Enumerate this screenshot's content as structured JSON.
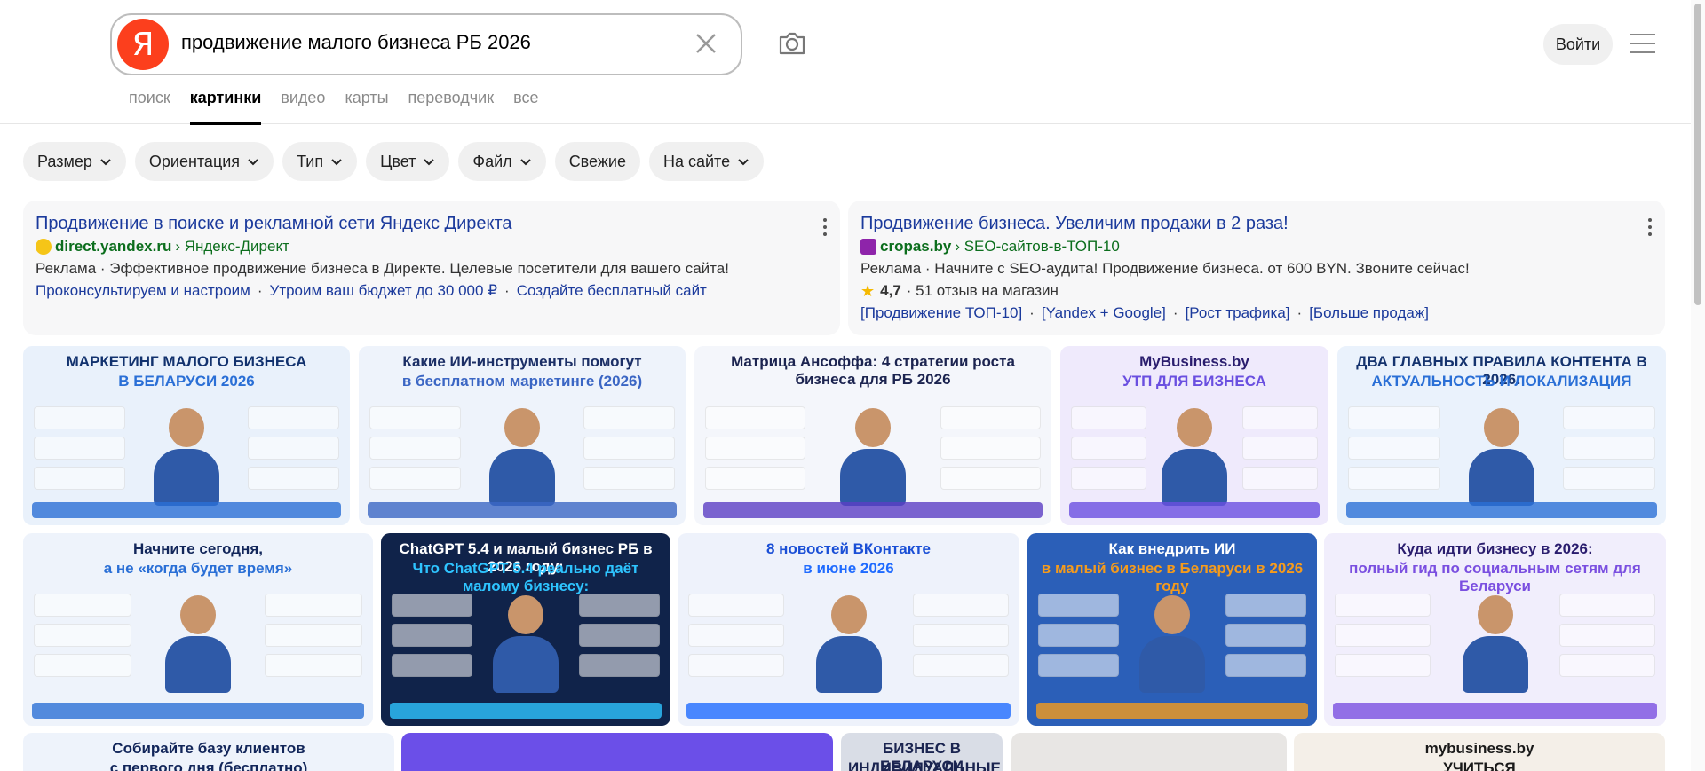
{
  "search": {
    "logo": "Я",
    "query": "продвижение малого бизнеса РБ 2026"
  },
  "header": {
    "login_label": "Войти"
  },
  "tabs": [
    {
      "label": "поиск"
    },
    {
      "label": "картинки"
    },
    {
      "label": "видео"
    },
    {
      "label": "карты"
    },
    {
      "label": "переводчик"
    },
    {
      "label": "все"
    }
  ],
  "filters": [
    {
      "label": "Размер"
    },
    {
      "label": "Ориентация"
    },
    {
      "label": "Тип"
    },
    {
      "label": "Цвет"
    },
    {
      "label": "Файл"
    },
    {
      "label": "Свежие"
    },
    {
      "label": "На сайте"
    }
  ],
  "ads": [
    {
      "title": "Продвижение в поиске и рекламной сети Яндекс Директа",
      "domain": "direct.yandex.ru",
      "path": "› Яндекс-Директ",
      "desc": "Реклама · Эффективное продвижение бизнеса в Директе. Целевые посетители для вашего сайта!",
      "links": [
        "Проконсультируем и настроим",
        "Утроим ваш бюджет до 30 000 ₽",
        "Создайте бесплатный сайт"
      ],
      "favicon_color": "#f5c518"
    },
    {
      "title": "Продвижение бизнеса. Увеличим продажи в 2 раза!",
      "domain": "cropas.by",
      "path": "› SEO-сайтов-в-ТОП-10",
      "desc": "Реклама · Начните с SEO-аудита! Продвижение бизнеса. от 600 BYN. Звоните сейчас!",
      "rating": "4,7",
      "reviews": "· 51 отзыв на магазин",
      "links": [
        "[Продвижение ТОП-10]",
        "[Yandex + Google]",
        "[Рост трафика]",
        "[Больше продаж]"
      ],
      "favicon_color": "#8e24aa"
    }
  ],
  "images_row1": [
    {
      "t1": "МАРКЕТИНГ МАЛОГО БИЗНЕСА",
      "t2": "В БЕЛАРУСИ 2026",
      "bg": "#e9f1fb",
      "fg": "#12326e",
      "accent": "#2a6fd6"
    },
    {
      "t1": "Какие ИИ-инструменты помогут",
      "t2": "в бесплатном маркетинге (2026)",
      "bg": "#eef3fb",
      "fg": "#1c2f66",
      "accent": "#3b66c4"
    },
    {
      "t1": "Матрица Ансоффа: 4 стратегии роста бизнеса для РБ 2026",
      "t2": "",
      "bg": "#f4f6fb",
      "fg": "#1c2450",
      "accent": "#5b3fc4"
    },
    {
      "t1": "MyBusiness.by",
      "t2": "УТП ДЛЯ БИЗНЕСА",
      "bg": "#efeafc",
      "fg": "#2a1d6e",
      "accent": "#6a4fe0"
    },
    {
      "t1": "ДВА ГЛАВНЫХ ПРАВИЛА КОНТЕНТА В 2026:",
      "t2": "АКТУАЛЬНОСТЬ И ЛОКАЛИЗАЦИЯ",
      "bg": "#eaf2fc",
      "fg": "#15336e",
      "accent": "#2a6fd6"
    }
  ],
  "images_row2": [
    {
      "t1": "Начните сегодня,",
      "t2": "а не «когда будет время»",
      "bg": "#eef3fb",
      "fg": "#12265a",
      "accent": "#2a6fd6"
    },
    {
      "t1": "ChatGPT 5.4 и малый бизнес РБ в 2026 году:",
      "t2": "Что ChatGPT 5.4 реально даёт малому бизнесу:",
      "bg": "#10234a",
      "fg": "#ffffff",
      "accent": "#2ec4ff"
    },
    {
      "t1": "8 новостей ВКонтакте",
      "t2": "в июне 2026",
      "bg": "#eef2fb",
      "fg": "#1a4fd6",
      "accent": "#1f6bff"
    },
    {
      "t1": "Как внедрить ИИ",
      "t2": "в малый бизнес в Беларуси в 2026 году",
      "bg": "#2b5fb8",
      "fg": "#ffffff",
      "accent": "#f59b1c"
    },
    {
      "t1": "Куда идти бизнесу в 2026:",
      "t2": "полный гид по социальным сетям для Беларуси",
      "bg": "#f1eefc",
      "fg": "#2a1d6e",
      "accent": "#7a4fe0"
    }
  ],
  "images_row3": [
    {
      "t1": "Собирайте базу клиентов",
      "t2": "с первого дня (бесплатно)",
      "bg": "#eef3fb",
      "fg": "#12265a"
    },
    {
      "t1": "",
      "t2": "",
      "bg": "#6b4fe8",
      "fg": "#ffffff"
    },
    {
      "t1": "БИЗНЕС В БЕЛАРУСИ",
      "t2": "ИНДИВИДУАЛЬНЫЕ ПРЕДПРИНИМАТЕЛЬСТВО",
      "bg": "#d9dde6",
      "fg": "#1a2450"
    },
    {
      "t1": "",
      "t2": "",
      "bg": "#e8e6e4",
      "fg": "#333333"
    },
    {
      "t1": "mybusiness.by",
      "t2": "УЧИТЬСЯ",
      "bg": "#f4efe8",
      "fg": "#1a1a1a"
    }
  ]
}
